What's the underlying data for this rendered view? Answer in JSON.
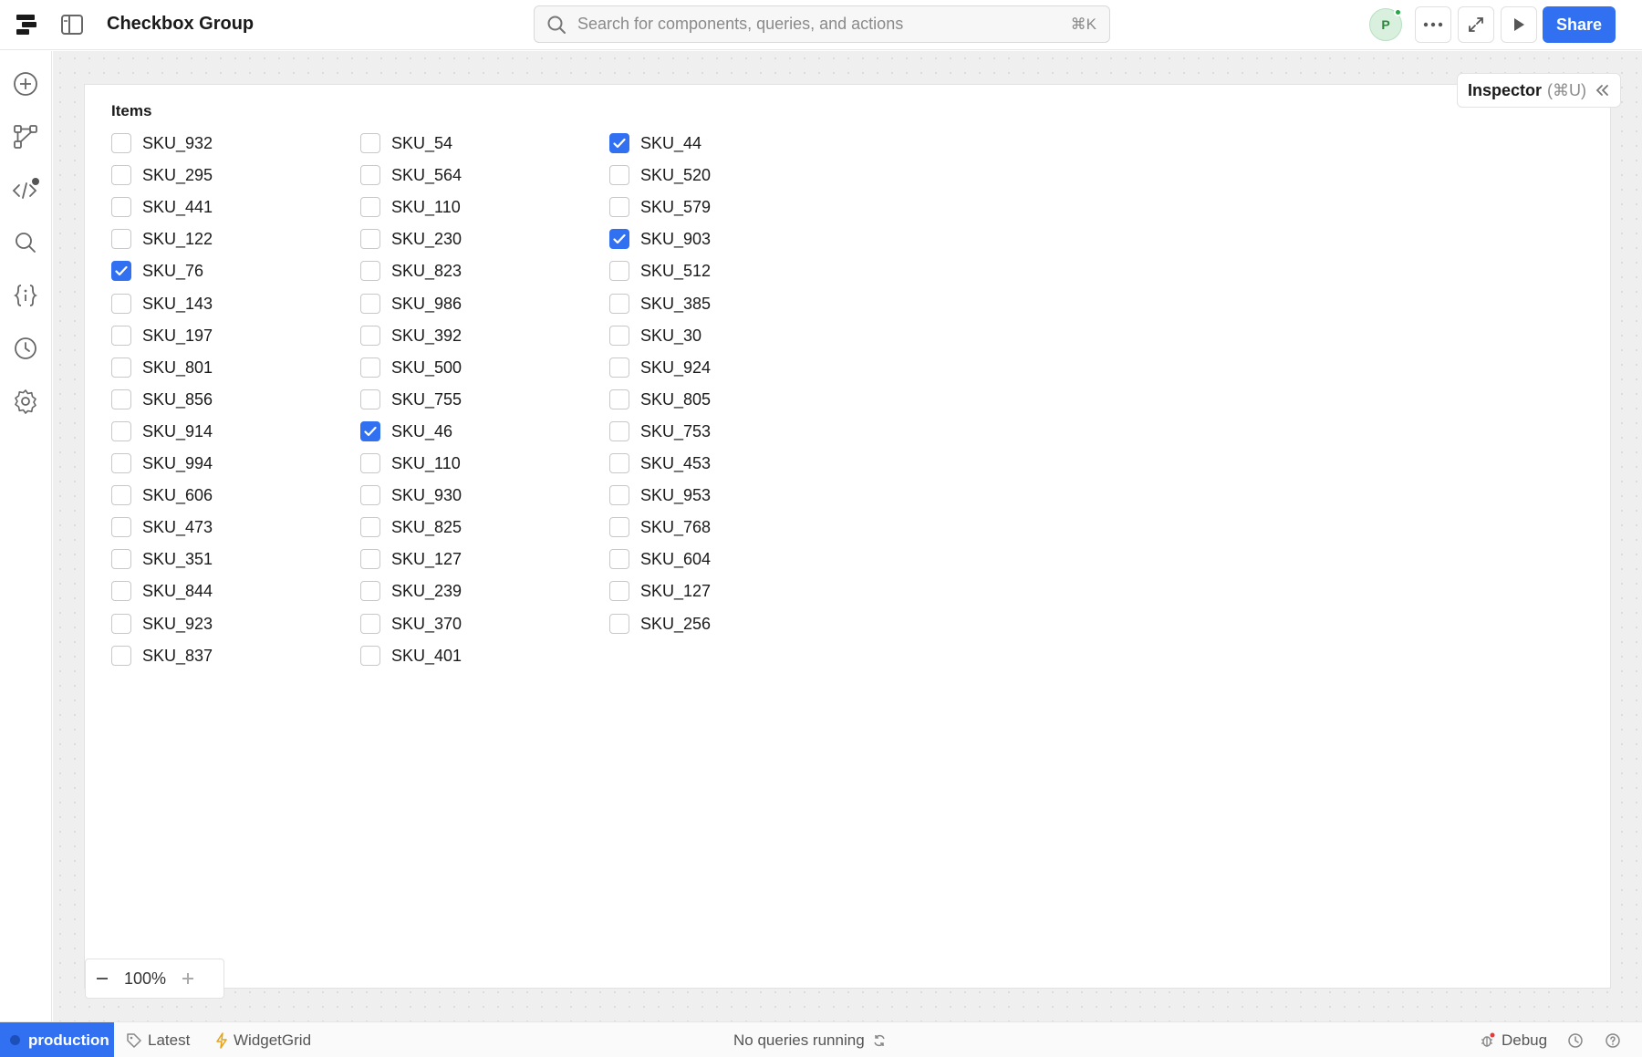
{
  "app": {
    "title": "Checkbox Group"
  },
  "search": {
    "placeholder": "Search for components, queries, and actions",
    "shortcut": "⌘K"
  },
  "user": {
    "avatar_initial": "P"
  },
  "toolbar": {
    "share_label": "Share"
  },
  "inspector": {
    "title": "Inspector",
    "shortcut": "(⌘U)"
  },
  "checkbox_group": {
    "label": "Items",
    "columns": [
      [
        {
          "label": "SKU_932",
          "checked": false
        },
        {
          "label": "SKU_295",
          "checked": false
        },
        {
          "label": "SKU_441",
          "checked": false
        },
        {
          "label": "SKU_122",
          "checked": false
        },
        {
          "label": "SKU_76",
          "checked": true
        },
        {
          "label": "SKU_143",
          "checked": false
        },
        {
          "label": "SKU_197",
          "checked": false
        },
        {
          "label": "SKU_801",
          "checked": false
        },
        {
          "label": "SKU_856",
          "checked": false
        },
        {
          "label": "SKU_914",
          "checked": false
        },
        {
          "label": "SKU_994",
          "checked": false
        },
        {
          "label": "SKU_606",
          "checked": false
        },
        {
          "label": "SKU_473",
          "checked": false
        },
        {
          "label": "SKU_351",
          "checked": false
        },
        {
          "label": "SKU_844",
          "checked": false
        },
        {
          "label": "SKU_923",
          "checked": false
        },
        {
          "label": "SKU_837",
          "checked": false
        }
      ],
      [
        {
          "label": "SKU_54",
          "checked": false
        },
        {
          "label": "SKU_564",
          "checked": false
        },
        {
          "label": "SKU_110",
          "checked": false
        },
        {
          "label": "SKU_230",
          "checked": false
        },
        {
          "label": "SKU_823",
          "checked": false
        },
        {
          "label": "SKU_986",
          "checked": false
        },
        {
          "label": "SKU_392",
          "checked": false
        },
        {
          "label": "SKU_500",
          "checked": false
        },
        {
          "label": "SKU_755",
          "checked": false
        },
        {
          "label": "SKU_46",
          "checked": true
        },
        {
          "label": "SKU_110",
          "checked": false
        },
        {
          "label": "SKU_930",
          "checked": false
        },
        {
          "label": "SKU_825",
          "checked": false
        },
        {
          "label": "SKU_127",
          "checked": false
        },
        {
          "label": "SKU_239",
          "checked": false
        },
        {
          "label": "SKU_370",
          "checked": false
        },
        {
          "label": "SKU_401",
          "checked": false
        }
      ],
      [
        {
          "label": "SKU_44",
          "checked": true
        },
        {
          "label": "SKU_520",
          "checked": false
        },
        {
          "label": "SKU_579",
          "checked": false
        },
        {
          "label": "SKU_903",
          "checked": true
        },
        {
          "label": "SKU_512",
          "checked": false
        },
        {
          "label": "SKU_385",
          "checked": false
        },
        {
          "label": "SKU_30",
          "checked": false
        },
        {
          "label": "SKU_924",
          "checked": false
        },
        {
          "label": "SKU_805",
          "checked": false
        },
        {
          "label": "SKU_753",
          "checked": false
        },
        {
          "label": "SKU_453",
          "checked": false
        },
        {
          "label": "SKU_953",
          "checked": false
        },
        {
          "label": "SKU_768",
          "checked": false
        },
        {
          "label": "SKU_604",
          "checked": false
        },
        {
          "label": "SKU_127",
          "checked": false
        },
        {
          "label": "SKU_256",
          "checked": false
        }
      ]
    ]
  },
  "zoom": {
    "value": "100%"
  },
  "statusbar": {
    "environment": "production",
    "version": "Latest",
    "widget": "WidgetGrid",
    "queries": "No queries running",
    "debug": "Debug"
  },
  "colors": {
    "accent": "#3170f0",
    "assist": "#c04fd6",
    "online": "#22a745"
  },
  "icons": {
    "rail": [
      "add-icon",
      "workflow-icon",
      "code-icon",
      "search-icon",
      "variables-icon",
      "history-icon",
      "settings-icon"
    ]
  }
}
